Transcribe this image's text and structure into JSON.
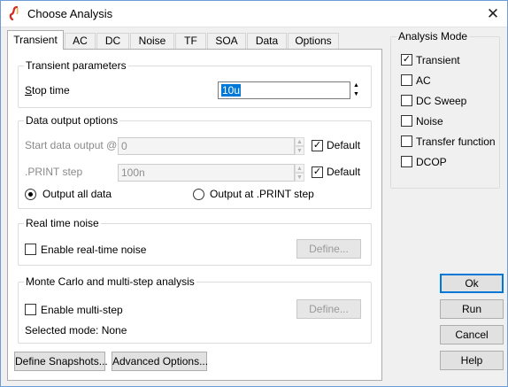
{
  "window": {
    "title": "Choose Analysis",
    "close_glyph": "✕",
    "icon": "spice-app-icon"
  },
  "tabs": [
    {
      "label": "Transient",
      "active": true
    },
    {
      "label": "AC",
      "active": false
    },
    {
      "label": "DC",
      "active": false
    },
    {
      "label": "Noise",
      "active": false
    },
    {
      "label": "TF",
      "active": false
    },
    {
      "label": "SOA",
      "active": false
    },
    {
      "label": "Data",
      "active": false
    },
    {
      "label": "Options",
      "active": false
    }
  ],
  "transient_params": {
    "group_title": "Transient parameters",
    "stop_time_label": "Stop time",
    "stop_time_value": "10u"
  },
  "data_output": {
    "group_title": "Data output options",
    "start_label": "Start data output @",
    "start_value": "0",
    "start_default_label": "Default",
    "start_default_checked": true,
    "print_step_label": ".PRINT step",
    "print_step_value": "100n",
    "print_default_label": "Default",
    "print_default_checked": true,
    "radio_all_label": "Output all data",
    "radio_all_selected": true,
    "radio_print_label": "Output at .PRINT step",
    "radio_print_selected": false
  },
  "noise": {
    "group_title": "Real time noise",
    "enable_label": "Enable real-time noise",
    "enable_checked": false,
    "define_label": "Define..."
  },
  "monte_carlo": {
    "group_title": "Monte Carlo and multi-step analysis",
    "enable_label": "Enable multi-step",
    "enable_checked": false,
    "define_label": "Define...",
    "selected_mode": "Selected mode: None"
  },
  "bottom_buttons": {
    "snapshots": "Define Snapshots...",
    "advanced": "Advanced Options..."
  },
  "analysis_mode": {
    "group_title": "Analysis Mode",
    "options": [
      {
        "label": "Transient",
        "checked": true
      },
      {
        "label": "AC",
        "checked": false
      },
      {
        "label": "DC Sweep",
        "checked": false
      },
      {
        "label": "Noise",
        "checked": false
      },
      {
        "label": "Transfer function",
        "checked": false
      },
      {
        "label": "DCOP",
        "checked": false
      }
    ]
  },
  "actions": {
    "ok": "Ok",
    "run": "Run",
    "cancel": "Cancel",
    "help": "Help"
  },
  "colors": {
    "accent": "#0078d7",
    "window_bg": "#f0f0f0",
    "icon_red": "#d6281e"
  }
}
